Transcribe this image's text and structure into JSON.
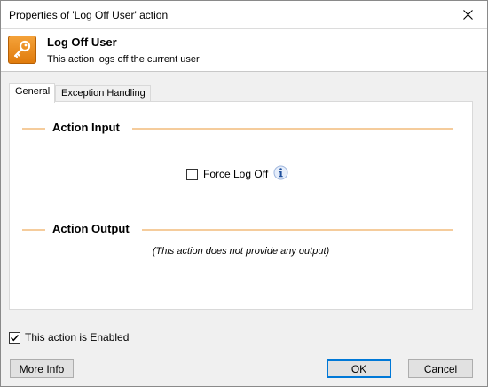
{
  "window": {
    "title": "Properties of 'Log Off User' action"
  },
  "header": {
    "title": "Log Off User",
    "description": "This action logs off the current user",
    "icon": "key-icon",
    "icon_color": "#e8860f"
  },
  "tabs": [
    {
      "label": "General",
      "active": true
    },
    {
      "label": "Exception Handling",
      "active": false
    }
  ],
  "action_input": {
    "heading": "Action Input",
    "force_log_off": {
      "label": "Force Log Off",
      "checked": false
    }
  },
  "action_output": {
    "heading": "Action Output",
    "message": "(This action does not provide any output)"
  },
  "enabled": {
    "label": "This action is Enabled",
    "checked": true
  },
  "buttons": {
    "more_info": "More Info",
    "ok": "OK",
    "cancel": "Cancel"
  },
  "colors": {
    "accent": "#0078d7",
    "section_line": "#f5cc9c"
  }
}
